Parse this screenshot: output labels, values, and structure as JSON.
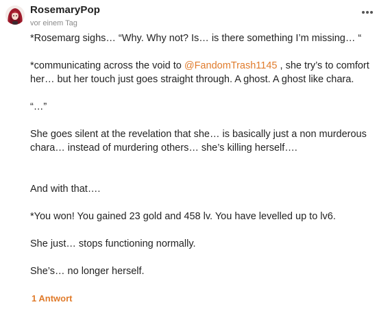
{
  "comment": {
    "author": "RosemaryPop",
    "timestamp": "vor einem Tag",
    "paragraphs": {
      "p1": "*Rosemarg sighs… “Why. Why not? Is… is there something I’m missing… “",
      "p2_before": "*communicating across the void to ",
      "p2_mention": "@FandomTrash1145",
      "p2_after": " , she try’s to comfort her… but her touch just goes straight through. A ghost. A ghost like chara.",
      "p3": "“…”",
      "p4": "She goes silent at the revelation that she… is basically just a non murderous chara… instead of murdering others… she’s killing herself….",
      "p5": "And with that….",
      "p6": "*You won! You gained 23 gold and 458 lv. You have levelled up to lv6.",
      "p7": "She just… stops functioning normally.",
      "p8": "She’s… no longer herself."
    },
    "reply_label": "1 Antwort"
  },
  "icons": {
    "avatar": "avatar-red-hair",
    "more": "more-options-icon"
  },
  "colors": {
    "accent": "#e07b2b",
    "text": "#222222",
    "muted": "#8a8a8a"
  }
}
